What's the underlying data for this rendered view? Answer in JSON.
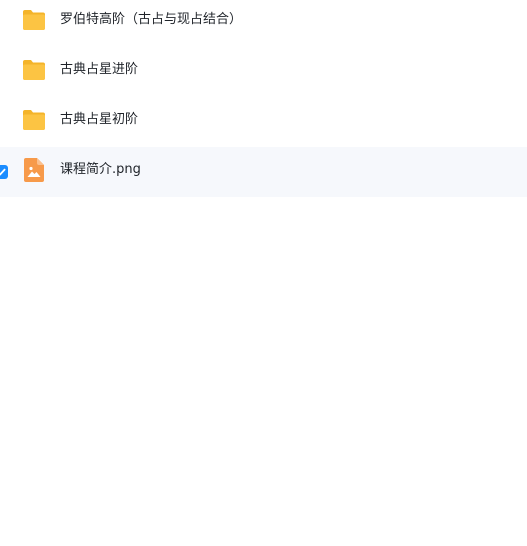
{
  "file_list": {
    "items": [
      {
        "name": "罗伯特高阶（古占与现占结合）",
        "type": "folder",
        "icon": "folder-icon",
        "selected": false
      },
      {
        "name": "古典占星进阶",
        "type": "folder",
        "icon": "folder-icon",
        "selected": false
      },
      {
        "name": "古典占星初阶",
        "type": "folder",
        "icon": "folder-icon",
        "selected": false
      },
      {
        "name": "课程简介.png",
        "type": "image",
        "icon": "image-file-icon",
        "selected": true
      }
    ]
  },
  "colors": {
    "folder": "#fcc443",
    "folder_back": "#f4b42a",
    "image_file": "#f79a4a",
    "checkbox": "#1a8cff",
    "selected_row": "#f6f8fc",
    "text": "#1f2329"
  }
}
